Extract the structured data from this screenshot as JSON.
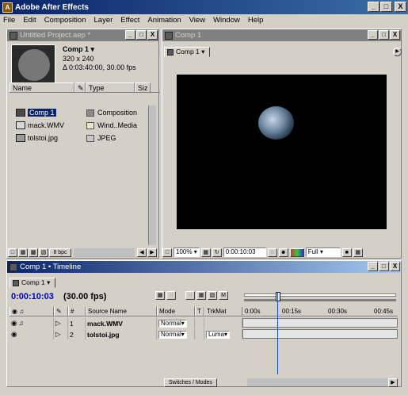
{
  "app": {
    "title": "Adobe After Effects",
    "icon_letter": "A",
    "window_buttons": [
      "_",
      "□",
      "X"
    ]
  },
  "menu": [
    "File",
    "Edit",
    "Composition",
    "Layer",
    "Effect",
    "Animation",
    "View",
    "Window",
    "Help"
  ],
  "project_panel": {
    "title": "Untitled Project.aep *",
    "panel_buttons": [
      "_",
      "□",
      "X"
    ],
    "selected_name": "Comp 1 ▾",
    "selected_size": "320 x 240",
    "selected_duration": "Δ 0:03:40:00, 30.00 fps",
    "columns": [
      "Name",
      "Type",
      "Siz"
    ],
    "items": [
      {
        "name": "Comp 1",
        "type": "Composition",
        "swatch": "#8a8a8a",
        "icon": "composition-icon"
      },
      {
        "name": "mack.WMV",
        "type": "Wind..Media",
        "swatch": "#e8e8c8",
        "icon": "footage-icon"
      },
      {
        "name": "tolstoi.jpg",
        "type": "JPEG",
        "swatch": "#c8c8c8",
        "icon": "image-icon"
      }
    ],
    "bpc_label": "8 bpc"
  },
  "comp_panel": {
    "title": "Comp 1",
    "tab": "Comp 1 ▾",
    "panel_buttons": [
      "_",
      "□",
      "X"
    ],
    "zoom": "100%",
    "timecode": "0:00:10:03",
    "resolution": "Full"
  },
  "timeline_panel": {
    "title": "Comp 1 • Timeline",
    "tab": "Comp 1 ▾",
    "panel_buttons": [
      "_",
      "□",
      "X"
    ],
    "current_time": "0:00:10:03",
    "fps": "(30.00 fps)",
    "columns": [
      "#",
      "Source Name",
      "Mode",
      "T",
      "TrkMat"
    ],
    "ruler_labels": [
      "0:00s",
      "00:15s",
      "00:30s",
      "00:45s"
    ],
    "layers": [
      {
        "index": "1",
        "name": "mack.WMV",
        "mode": "Normal",
        "trkmat": ""
      },
      {
        "index": "2",
        "name": "tolstoi.jpg",
        "mode": "Normal",
        "trkmat": "Luma"
      }
    ],
    "switches_label": "Switches / Modes"
  }
}
